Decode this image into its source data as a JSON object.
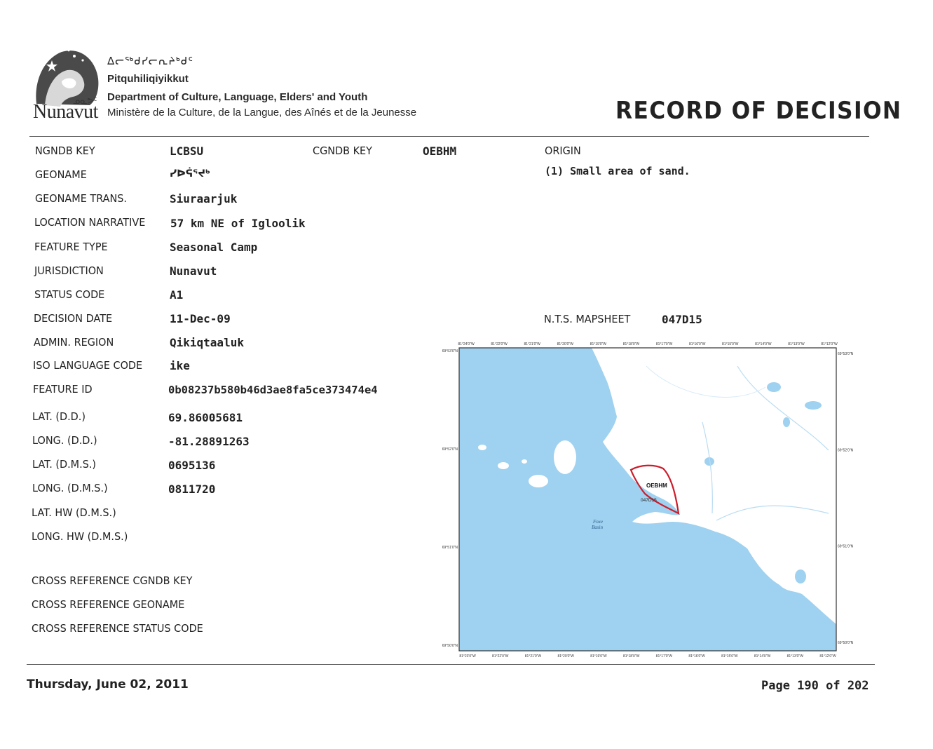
{
  "header": {
    "syllabics_title": "ᐃᓕᖅᑯᓯᓕᕆᔨᒃᑯᑦ",
    "dept_inuktitut": "Pitquhiliqiyikkut",
    "dept_english": "Department of Culture, Language, Elders' and Youth",
    "dept_french": "Ministère de la Culture, de la Langue, des Aînés et de la Jeunesse",
    "logo_word": "Nunavut",
    "doc_title": "RECORD OF DECISION"
  },
  "record": {
    "ngndb_key_label": "NGNDB KEY",
    "ngndb_key": "LCBSU",
    "cgndb_key_label": "CGNDB KEY",
    "cgndb_key": "OEBHM",
    "origin_label": "ORIGIN",
    "origin": "(1) Small area of sand.",
    "geoname_label": "GEONAME",
    "geoname": "ᓯᐅᕌᕐᔪᒃ",
    "geoname_trans_label": "GEONAME TRANS.",
    "geoname_trans": "Siuraarjuk",
    "location_label": "LOCATION NARRATIVE",
    "location": "57 km NE of Igloolik",
    "feature_type_label": "FEATURE TYPE",
    "feature_type": "Seasonal Camp",
    "jurisdiction_label": "JURISDICTION",
    "jurisdiction": "Nunavut",
    "status_code_label": "STATUS CODE",
    "status_code": "A1",
    "decision_date_label": "DECISION DATE",
    "decision_date": "11-Dec-09",
    "nts_label": "N.T.S. MAPSHEET",
    "nts": "047D15",
    "admin_region_label": "ADMIN. REGION",
    "admin_region": "Qikiqtaaluk",
    "iso_label": "ISO LANGUAGE CODE",
    "iso": "ike",
    "feature_id_label": "FEATURE ID",
    "feature_id": "0b08237b580b46d3ae8fa5ce373474e4",
    "lat_dd_label": "LAT. (D.D.)",
    "lat_dd": "69.86005681",
    "long_dd_label": "LONG. (D.D.)",
    "long_dd": "-81.28891263",
    "lat_dms_label": "LAT. (D.M.S.)",
    "lat_dms": "0695136",
    "long_dms_label": "LONG. (D.M.S.)",
    "long_dms": "0811720",
    "lat_hw_label": "LAT. HW (D.M.S.)",
    "long_hw_label": "LONG. HW (D.M.S.)",
    "xref_cgndb_label": "CROSS REFERENCE CGNDB KEY",
    "xref_geoname_label": "CROSS REFERENCE GEONAME",
    "xref_status_label": "CROSS REFERENCE STATUS CODE"
  },
  "map": {
    "feature_label": "OEBHM",
    "sheet_label": "047D15",
    "water_label_1": "Foxe",
    "water_label_2": "Basin",
    "top_ticks": [
      "81°24'0\"W",
      "81°22'0\"W",
      "81°21'0\"W",
      "81°20'0\"W",
      "81°19'0\"W",
      "81°18'0\"W",
      "81°17'0\"W",
      "81°16'0\"W",
      "81°15'0\"W",
      "81°14'0\"W",
      "81°13'0\"W",
      "81°12'0\"W"
    ],
    "bottom_ticks": [
      "81°23'0\"W",
      "81°22'0\"W",
      "81°21'0\"W",
      "81°20'0\"W",
      "81°19'0\"W",
      "81°18'0\"W",
      "81°17'0\"W",
      "81°16'0\"W",
      "81°15'0\"W",
      "81°14'0\"W",
      "81°13'0\"W",
      "81°12'0\"W"
    ],
    "left_ticks": [
      "69°53'0\"N",
      "69°52'0\"N",
      "69°51'0\"N",
      "69°50'0\"N"
    ],
    "right_ticks": [
      "69°53'0\"N",
      "69°52'0\"N",
      "69°51'0\"N",
      "69°50'0\"N"
    ],
    "colors": {
      "water": "#9fd1f0",
      "land": "#ffffff",
      "feature_outline": "#cc1d2a",
      "stream": "#b9dcf2"
    }
  },
  "footer": {
    "date": "Thursday, June 02, 2011",
    "page": "Page 190 of 202"
  }
}
